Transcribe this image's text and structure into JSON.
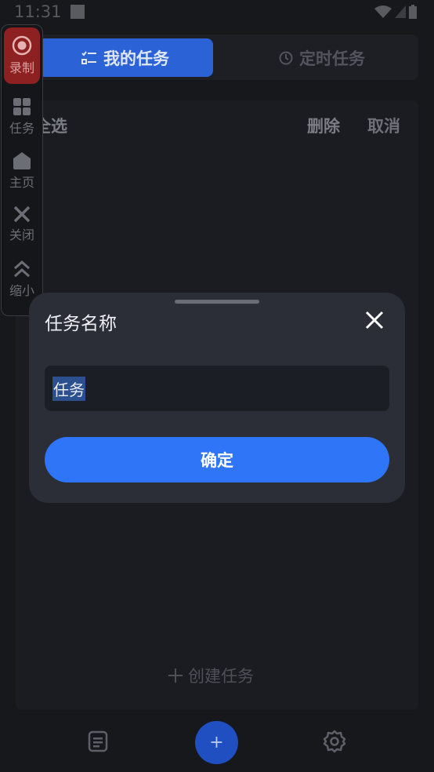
{
  "status": {
    "time": "11:31"
  },
  "tabs": {
    "my_tasks": "我的任务",
    "scheduled_tasks": "定时任务"
  },
  "toolbar": {
    "select_all": "全选",
    "delete": "删除",
    "cancel": "取消"
  },
  "panel": {
    "create_task": "创建任务"
  },
  "floating_bar": {
    "record": "录制",
    "tasks": "任务",
    "home": "主页",
    "close": "关闭",
    "minimize": "缩小"
  },
  "dialog": {
    "title": "任务名称",
    "input_value": "任务",
    "confirm": "确定"
  },
  "colors": {
    "accent": "#2f75f7",
    "tab_active": "#2b63d6",
    "record_red": "#8d2020",
    "background": "#17181c"
  }
}
